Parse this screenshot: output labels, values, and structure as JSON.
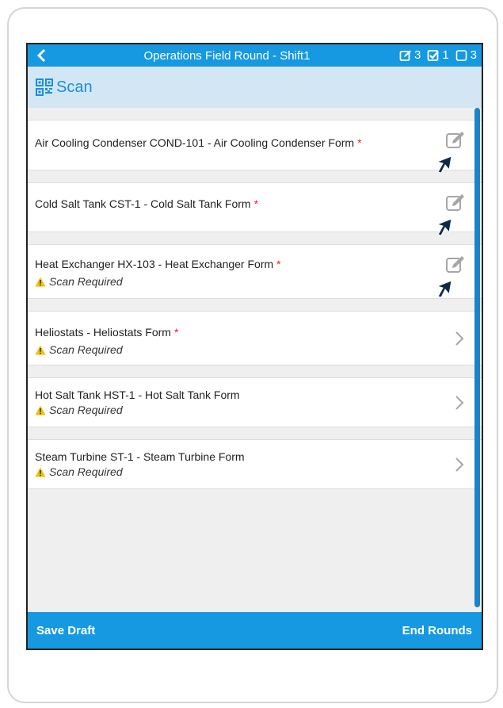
{
  "header": {
    "title": "Operations Field Round - Shift1",
    "counts": {
      "edited": "3",
      "checked": "1",
      "unchecked": "3"
    }
  },
  "scan": {
    "label": "Scan"
  },
  "items": [
    {
      "name": "Air Cooling Condenser COND-101 - Air Cooling Condenser Form",
      "required": "*",
      "status": "",
      "action": "edit-icon"
    },
    {
      "name": "Cold Salt Tank CST-1 - Cold Salt Tank Form",
      "required": "*",
      "status": "",
      "action": "edit-icon"
    },
    {
      "name": "Heat Exchanger HX-103 - Heat Exchanger Form",
      "required": "*",
      "status": "Scan Required",
      "action": "edit-icon"
    },
    {
      "name": "Heliostats - Heliostats Form",
      "required": "*",
      "status": "Scan Required",
      "action": "chevron-right-icon"
    },
    {
      "name": "Hot Salt Tank HST-1 - Hot Salt Tank Form",
      "required": "",
      "status": "Scan Required",
      "action": "chevron-right-icon"
    },
    {
      "name": "Steam Turbine ST-1 - Steam Turbine Form",
      "required": "",
      "status": "Scan Required",
      "action": "chevron-right-icon"
    }
  ],
  "footer": {
    "save_label": "Save Draft",
    "end_label": "End Rounds"
  },
  "colors": {
    "primary": "#1699e0",
    "scan_bg": "#d3e6f3",
    "required": "#e0202e",
    "warning": "#f2c200"
  }
}
